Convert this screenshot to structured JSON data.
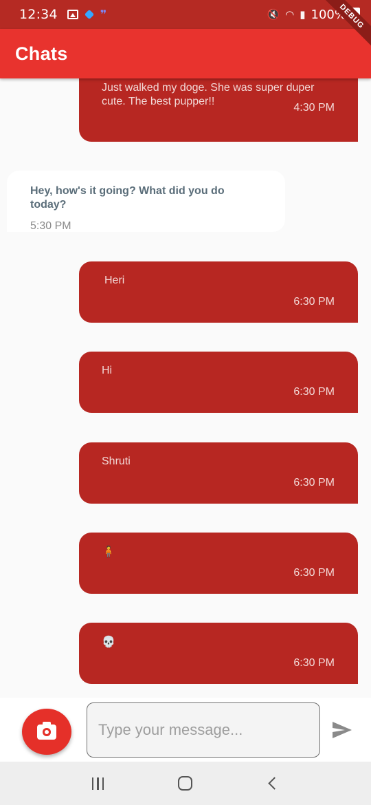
{
  "status_bar": {
    "time": "12:34",
    "battery": "100%",
    "icons": [
      "image-icon",
      "notification-dot-icon",
      "quote-icon",
      "mute-icon",
      "wifi-icon",
      "signal-icon",
      "battery-icon"
    ]
  },
  "debug_banner": "DEBUG",
  "app_bar": {
    "title": "Chats",
    "color": "#e8332e"
  },
  "messages": [
    {
      "type": "sent",
      "text": "Just walked my doge. She was super duper cute. The best pupper!!",
      "time": "4:30 PM"
    },
    {
      "type": "received",
      "text": "Hey, how's it going? What did you do today?",
      "time": "5:30 PM"
    },
    {
      "type": "sent",
      "text": "Heri",
      "time": "6:30 PM"
    },
    {
      "type": "sent",
      "text": "Hi",
      "time": "6:30 PM"
    },
    {
      "type": "sent",
      "text": "Shruti",
      "time": "6:30 PM"
    },
    {
      "type": "sent",
      "text": "🧍",
      "time": "6:30 PM"
    },
    {
      "type": "sent",
      "text": "💀",
      "time": "6:30 PM"
    }
  ],
  "input": {
    "placeholder": "Type your message...",
    "value": ""
  },
  "colors": {
    "sent_bubble": "#b72722",
    "received_bubble": "#ffffff",
    "accent": "#e53029"
  }
}
